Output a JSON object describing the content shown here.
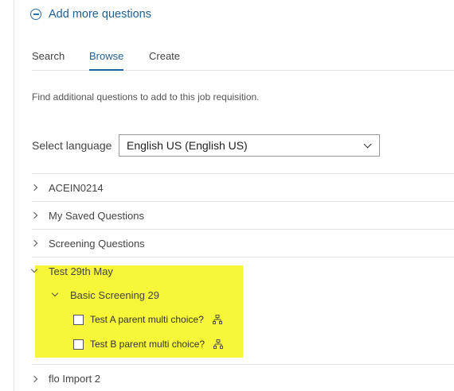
{
  "header": {
    "add_more_label": "Add more questions"
  },
  "tabs": [
    {
      "label": "Search"
    },
    {
      "label": "Browse",
      "active": true
    },
    {
      "label": "Create"
    }
  ],
  "hint": "Find additional questions to add to this job requisition.",
  "language": {
    "label": "Select language",
    "value": "English US (English US)"
  },
  "folders": [
    {
      "label": "ACEIN0214",
      "expanded": false
    },
    {
      "label": "My Saved Questions",
      "expanded": false
    },
    {
      "label": "Screening Questions",
      "expanded": false
    },
    {
      "label": "Test 29th May",
      "expanded": true
    }
  ],
  "subfolder": {
    "label": "Basic Screening 29",
    "expanded": true,
    "questions": [
      {
        "label": "Test A parent multi choice?",
        "checked": false
      },
      {
        "label": "Test B parent multi choice?",
        "checked": false
      }
    ]
  },
  "last_folder": {
    "label": "flo Import 2",
    "expanded": false
  },
  "colors": {
    "accent": "#1f5f96",
    "highlight": "#f7f73a"
  }
}
